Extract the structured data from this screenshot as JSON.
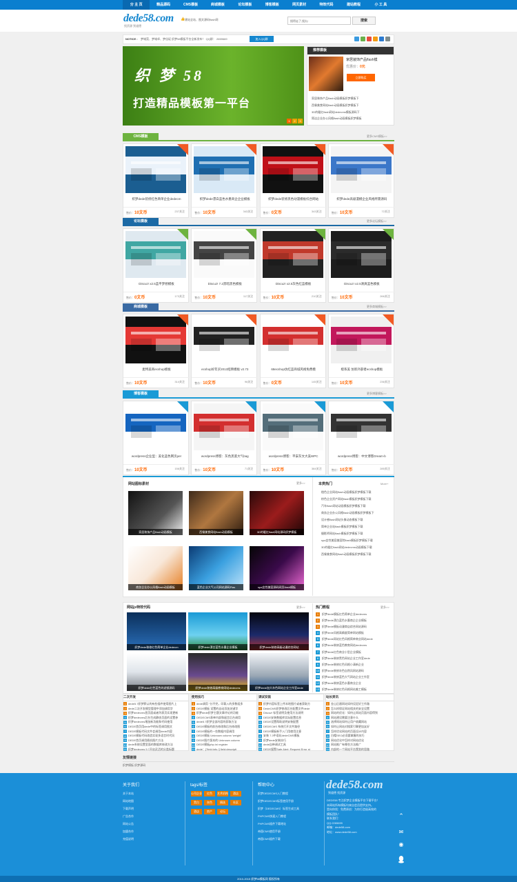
{
  "nav": {
    "items": [
      "分 主 页",
      "精品源码",
      "CMS模板",
      "商城模板",
      "论坛模板",
      "博客模板",
      "网页素材",
      "特效代码",
      "建站教程",
      "小 工 具"
    ]
  },
  "header": {
    "logo": "dede58.com",
    "logo_sub": "找资源  到道德",
    "slogan": "建站全站、图文源码flash网",
    "search_placeholder": "搜得走了,搜丸!",
    "search_button": "搜索"
  },
  "notice": {
    "label": "NOTICE :",
    "text": "梦域莞、梦域卓、梦佳砭 织梦58模板平台全新发布！  QQ群：  2659669",
    "qq_button": "加入QQ群"
  },
  "banner": {
    "title": "织 梦 58",
    "subtitle": "打造精品模板第一平台",
    "dots": [
      "1",
      "2",
      "3"
    ]
  },
  "recommend": {
    "head": "推荐模板",
    "title": "家居装饰产品flash模",
    "price_label": "优惠价：",
    "price_value": "0元",
    "buy": "立即购买",
    "list": [
      "家居装饰产品flash动画模板织梦模板下",
      "西餐美食网站flash动画模板织梦模板下",
      "3D的暖红flash网站dedecms模板源码下",
      "简洁企业办公风格flash动画模板织梦模板"
    ]
  },
  "sections": [
    {
      "tab": "CMS模板",
      "more": "更多CMS模板>>",
      "color": "#6db33f",
      "corner": "#f15a24",
      "cards": [
        {
          "title": "织梦dede装修红色简单企业dedecm",
          "price": "10文币",
          "fav": "237关注"
        },
        {
          "title": "织梦dede漂白蓝色水墨商企企业模板",
          "price": "10文币",
          "fav": "343关注"
        },
        {
          "title": "织梦dede装修黑色动漫模板综合网站",
          "price": "0文币",
          "fav": "343关注"
        },
        {
          "title": "织梦dede高级漫模企业风格所需源码",
          "price": "10文币",
          "fav": "72关注"
        }
      ]
    },
    {
      "tab": "论坛模板",
      "more": "更多论坛模板>>",
      "color": "#1c6aa5",
      "corner": "#6db33f",
      "cards": [
        {
          "title": "Discuz! x2.5蓝平梦想模板",
          "price": "0文币",
          "fav": "173关注"
        },
        {
          "title": "Discuz! 7.2黑暗黑色模板",
          "price": "10文币",
          "fav": "117关注"
        },
        {
          "title": "Discuz! x2.5灰色红蓝模板",
          "price": "10文币",
          "fav": "210关注"
        },
        {
          "title": "Discuz! x2.5清爽蓝色模板",
          "price": "10文币",
          "fav": "266关注"
        }
      ]
    },
    {
      "tab": "商城模板",
      "more": "更多商城模板>>",
      "color": "#3a6aa3",
      "corner": "#f15a24",
      "cards": [
        {
          "title": "麦特美商ecshop模板",
          "price": "10文币",
          "fav": "314关注"
        },
        {
          "title": "ecshop好年买2013招牌模板 v2.73",
          "price": "10文币",
          "fav": "96关注"
        },
        {
          "title": "68ecshop仿红蓝商城风格免费模",
          "price": "0文币",
          "fav": "145关注"
        },
        {
          "title": "橙系美 仿新外部者ecshop模板",
          "price": "10文币",
          "fav": "236关注"
        }
      ]
    },
    {
      "tab": "博客模板",
      "more": "更多博客模板>>",
      "color": "#1a9ad6",
      "corner": "#1a9ad6",
      "cards": [
        {
          "title": "wordpress企业型：美化蓝色网页per",
          "price": "10文币",
          "fav": "156关注"
        },
        {
          "title": "wordpress博客：灰色黑底大气bag",
          "price": "10文币",
          "fav": "71关注"
        },
        {
          "title": "wordpress博客：平安灰文大美WPC",
          "price": "10文币",
          "fav": "384关注"
        },
        {
          "title": "wordpress博客：中文博客Dream-b",
          "price": "10文币",
          "fav": "285关注"
        }
      ]
    }
  ],
  "material": {
    "title": "网站图标素材",
    "more": "更多>>",
    "tiles": [
      "家居装饰产品flash动画模板",
      "西餐美食网站flash动画模板",
      "3D的暖红flash网站源码织梦模板",
      "商务企业办公风格flash动画模板",
      "蓝色企业大气公司网站源码Flas",
      "spa女性美容源码网页flash模板"
    ]
  },
  "hot": {
    "title": "本类热门",
    "more": "More+",
    "items": [
      "橙色企业网站flash动画模板织梦模板下载",
      "棕色企业资产网站flash模板织梦模板下载",
      "汽车flash网站动画模板织梦模板下载",
      "商务企业办公风格flash动画模板织梦模板下",
      "设计感flash网站头像动态模板下载",
      "简单企业站flash模板织梦模板下载",
      "摄影师网站flash模板织梦模板下载",
      "spa女性美容美容院flash模板织梦模板下载",
      "3D的暖红flash网站dedecms动画模板下载",
      "西餐美食网站flash动画模板织梦模板下载"
    ]
  },
  "effects": {
    "title": "网站js特效代码",
    "more": "更多>>",
    "tiles": [
      "织梦dede装修红色简单企业dedecm",
      "织梦dede漂白蓝色水墨企业模板",
      "织梦dede装修高级动漫综合网站",
      "织梦dede红色蓝色的滤镜源码",
      "织梦dede装修高级教育网站dedecms",
      "织梦dede加大灰色网站企业工作室dede"
    ]
  },
  "tutorial": {
    "title": "热门教程",
    "more": "更多>>",
    "items": [
      "织梦dede模板红色简单企业dedecms",
      "织梦dede漂白蓝色水墨商企企业模板",
      "织梦dede模板动漫商店综合网站源码",
      "织梦dede风格高精度简单网站模板",
      "织梦dede网站红色风格简单商业网站dede",
      "织梦dede装修蓝色教育网站dedecms",
      "织梦dede红色商业小型企业模板",
      "织梦dede装修黑色网站企业工作室dede",
      "织梦dede装修红色风格小清新企业",
      "织梦dede装修灰色自然风网站源码",
      "织梦dede装修蓝色大气网站企业工作室",
      "织梦dede装修蓝色水墨商业企业",
      "织梦dede装修红色风格网站美工模板"
    ]
  },
  "lists": [
    {
      "title": "二次开发",
      "items": [
        "dede5.7织梦默认的有些插件使用图片上",
        "dede二次开发模型管理中添加调用字",
        "织梦dedecms首页面或者列表页实现更新",
        "织梦dedecms后台生成静态页面的设置参",
        "织梦dedecms增加新功能和代码使用",
        "DEDE首页用dede中的标签调用图文",
        "DEDE模板代码文件会调用dede内容",
        "DEDE模板代码改造实现多语言时代风",
        "DEDE首页调用随机图片方法",
        "dede系统设置里面的数据库修改方法",
        "织梦dedecms 5.7开启灵活的分类标题"
      ]
    },
    {
      "title": "使用技巧",
      "items": [
        "dede调用 \"分不完，印载入的多数组多",
        "DEDE模板 设置的自动添加关键字",
        "织梦dede织梦主题文章评论的功能",
        "DEDECMS表单内部和留言后台调用",
        "dede5.7织梦全部内容的获取方法",
        "DEDE模板的前台修改和后台修改图",
        "DEDE模板的一些数据内容调用",
        "DEDE模板 Unknown column 'weight'",
        "DEDE图片版本的 Unknown column",
        "DEDE模板php.ini register",
        "dede：[\"field:info /] field:descripti"
      ]
    },
    {
      "title": "调试安装",
      "items": [
        "织梦内容标签上传本地图片或者获取方",
        "DedeCMS织梦修改后台配置文件dede",
        "Discuz! 标签说明及使用方法说明",
        "DEDE安装数据库实际配置信息",
        "DEDE设置帮助说明安装配置",
        "DEDECMS 系统打开文件路径",
        "DEDE模板新手入门用使用注意",
        "安装 7.3中语化dedeCMS模板",
        "织梦dede安装技巧",
        "dede自带调试工具",
        "DEDE报警Safe Alert: Request Error st"
      ]
    },
    {
      "title": "站长资讯",
      "items": [
        "金山后盾网站如何设定好工作路",
        "怎么样保证网站相关的安全设置",
        "网站的优化：如何让网站页面内容得到",
        "网站建设需要注意什么",
        "选择网站如何让用户收藏网站",
        "如何让网站对搜索引擎更加友好",
        "怎样优化网站的页面设计内容",
        "白帽SEO必须要掌握的技巧",
        "网站优化中怎样对网站优化",
        "网站推广有哪些方法推广",
        "内部的一个网站平台策划的思路"
      ]
    }
  ],
  "friendlinks": {
    "title": "友情链接",
    "items": [
      "织梦模板",
      "织梦源码"
    ]
  },
  "footer": {
    "about_title": "关于我们",
    "about_links": [
      "关于本站",
      "网站地图",
      "下载声明",
      "广告合作",
      "网站公告",
      "加盟合作",
      "充值说明"
    ],
    "tags_title": "tags/标签",
    "tags": [
      "公司企业",
      "红色",
      "艺术机构",
      "酒店",
      "黑白",
      "灰色",
      "摘选",
      "社区",
      "酒店",
      "房产",
      "论坛"
    ],
    "help_title": "帮助中心",
    "help_links": [
      "织梦DEDECMS入门教程",
      "织梦DEDECMS标签使用手册",
      "织梦（DEDECMS）标签生成工具",
      "PHPCMS快速入门教程",
      "PHPCMS插件下载地址",
      "帝国CMS使用手册",
      "帝国CMS插件下载"
    ],
    "logo": "dede58.com",
    "logo_sub": "到道德  找资源",
    "desc": [
      "DEDE58 专注织梦企业模板平台下载平台！",
      "本网站所有模板均来自会员提供支持。",
      "是向你找：免费原创：为你打造极高效的",
      "模板团队！",
      "联系我们：",
      "QQ:2265699",
      "邮箱：dede58.com",
      "地址：www.dede58.com"
    ],
    "copyright": "2010-2015 织梦58模板网 版权所有"
  }
}
